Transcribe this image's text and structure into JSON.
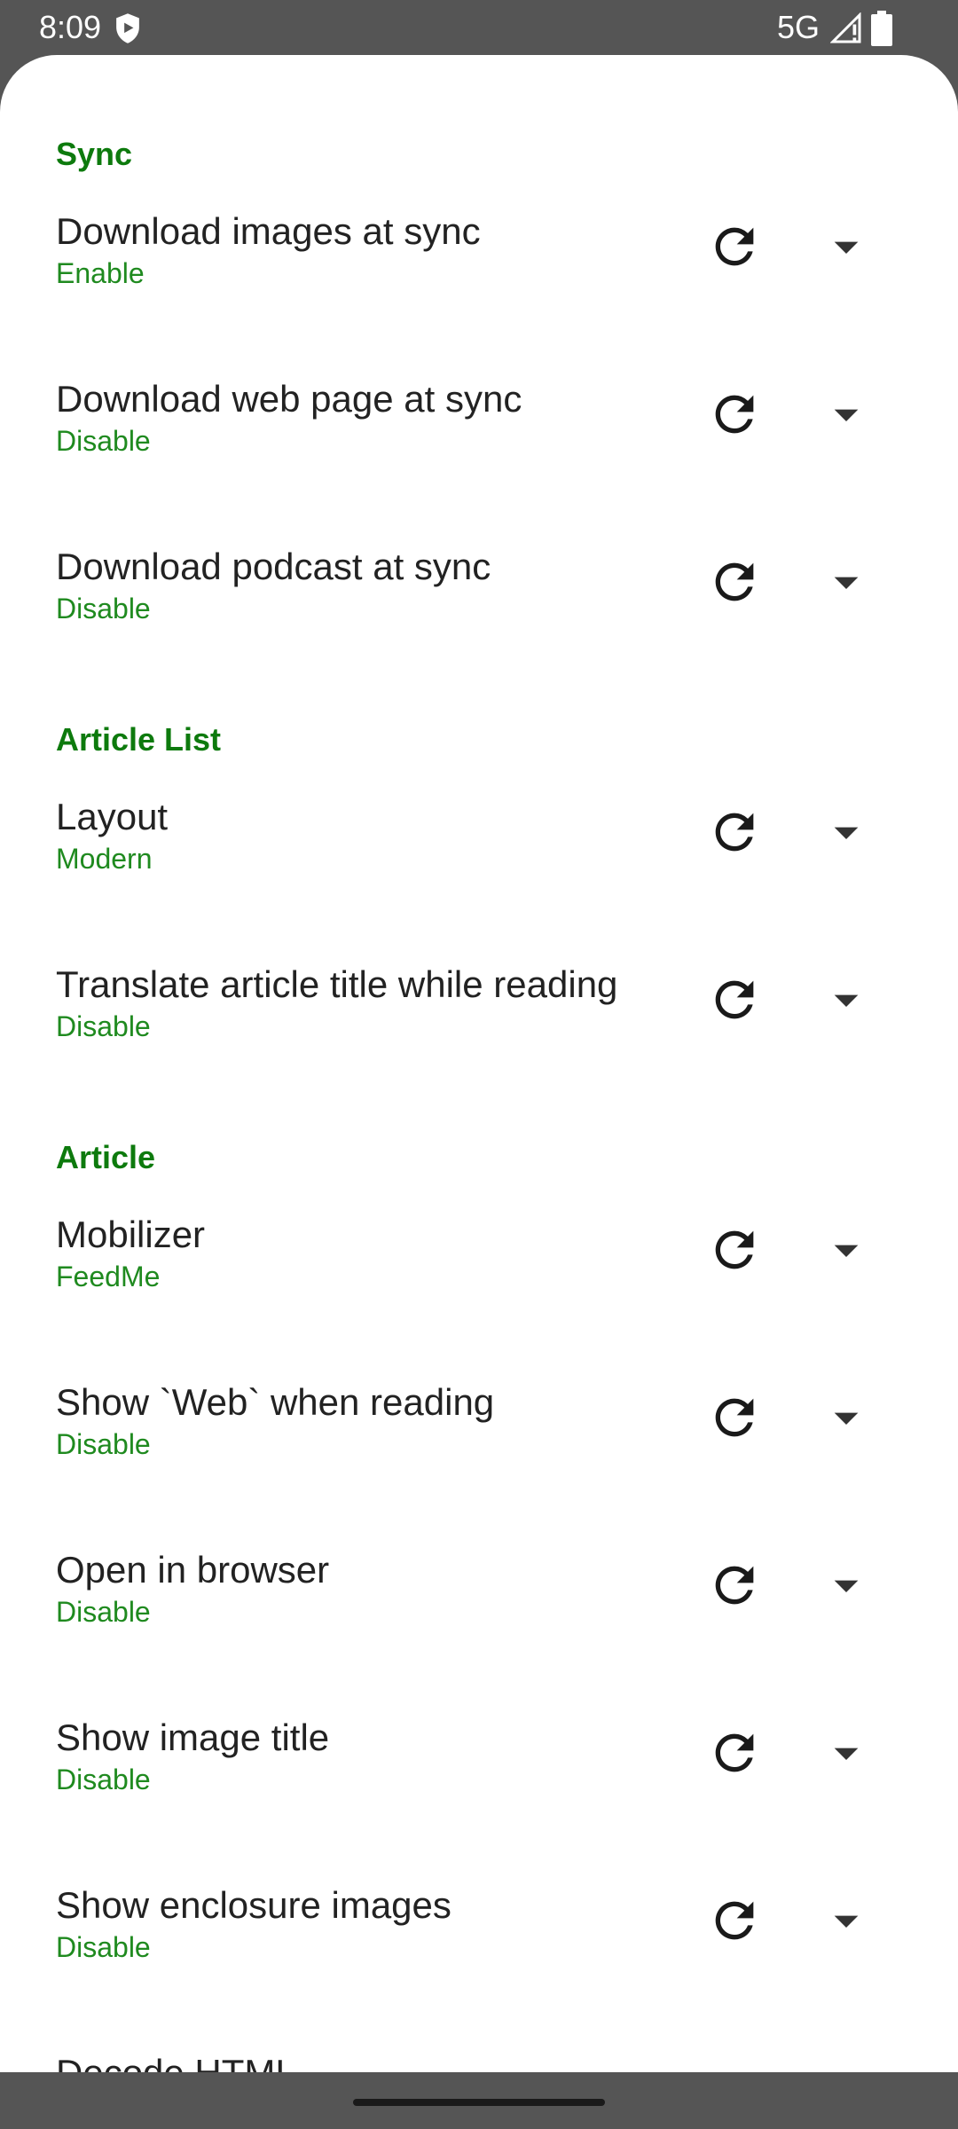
{
  "status_bar": {
    "time": "8:09",
    "network": "5G",
    "icons": [
      "shield-icon",
      "signal-icon",
      "battery-icon"
    ]
  },
  "colors": {
    "accent": "#0d7a0d",
    "subtitle": "#1f8a1f",
    "title": "#222222",
    "background": "#ffffff"
  },
  "sections": [
    {
      "title": "Sync",
      "items": [
        {
          "title": "Download images at sync",
          "value": "Enable"
        },
        {
          "title": "Download web page at sync",
          "value": "Disable"
        },
        {
          "title": "Download podcast at sync",
          "value": "Disable"
        }
      ]
    },
    {
      "title": "Article List",
      "items": [
        {
          "title": "Layout",
          "value": "Modern"
        },
        {
          "title": "Translate article title while reading",
          "value": "Disable"
        }
      ]
    },
    {
      "title": "Article",
      "items": [
        {
          "title": "Mobilizer",
          "value": "FeedMe"
        },
        {
          "title": "Show `Web` when reading",
          "value": "Disable"
        },
        {
          "title": "Open in browser",
          "value": "Disable"
        },
        {
          "title": "Show image title",
          "value": "Disable"
        },
        {
          "title": "Show enclosure images",
          "value": "Disable"
        },
        {
          "title": "Decode HTML",
          "value": ""
        }
      ]
    }
  ],
  "row_icons": {
    "reset": "refresh-icon",
    "dropdown": "dropdown-arrow-icon"
  }
}
